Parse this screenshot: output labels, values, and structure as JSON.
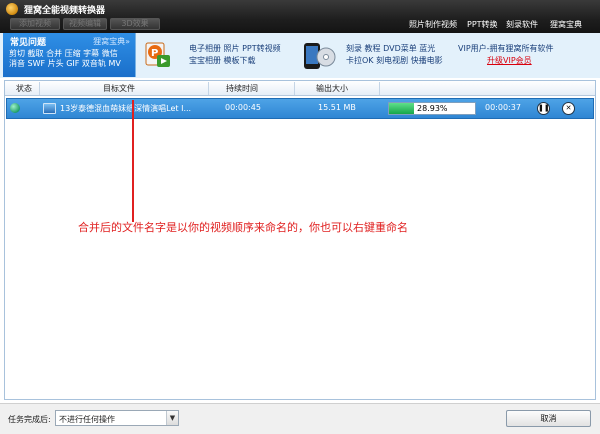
{
  "window": {
    "title": "狸窝全能视频转换器"
  },
  "toolbar": {
    "buttons": [
      "添加视频",
      "视频编辑",
      "3D效果"
    ]
  },
  "top_menu": [
    "照片制作视频",
    "PPT转换",
    "刻录软件",
    "狸窝宝典"
  ],
  "banner": {
    "faq_title": "常见问题",
    "faq_subtitle": "狸窝宝典»",
    "faq_line1": "剪切 截取 合并 压缩 字幕 微信",
    "faq_line2": "消音 SWF 片头 GIF 双音轨 MV",
    "ppt_line1": "电子相册 照片 PPT转视频",
    "ppt_line2": "宝宝相册 模板下载",
    "phone_line1": "刻录 教程 DVD菜单 蓝光",
    "phone_line2": "卡拉OK 刻电视剧 快播电影",
    "vip_line1": "VIP用户-拥有狸窝所有软件",
    "vip_line2": "升级VIP会员"
  },
  "list": {
    "columns": [
      "状态",
      "目标文件",
      "持续时间",
      "输出大小"
    ],
    "rows": [
      {
        "name": "13岁泰德混血萌妹纸深情演唱Let I...",
        "duration": "00:00:45",
        "size": "15.51 MB",
        "progress_text": "28.93%",
        "progress": 0.2893,
        "elapsed": "00:00:37"
      }
    ]
  },
  "annotation": "合并后的文件名字是以你的视频顺序来命名的，你也可以右键重命名",
  "footer": {
    "after_label": "任务完成后:",
    "after_value": "不进行任何操作",
    "cancel_label": "取消"
  },
  "colors": {
    "accent": "#2f86d4",
    "annotation": "#e02020",
    "vip_link": "#d9000d"
  }
}
